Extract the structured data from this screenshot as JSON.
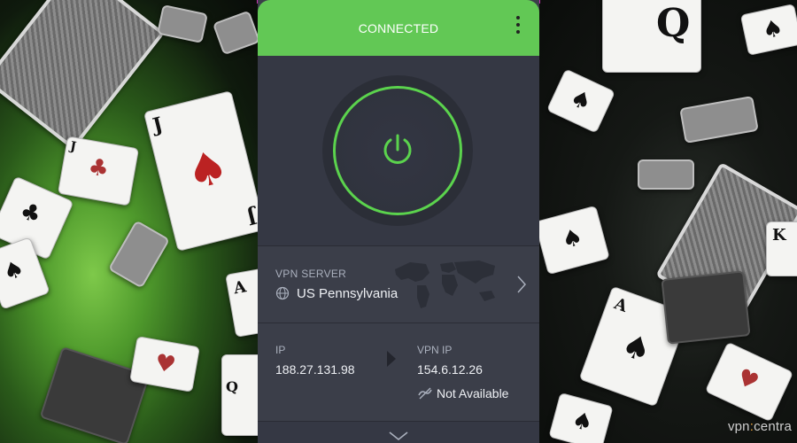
{
  "vpn": {
    "status": "CONNECTED",
    "menu_icon": "kebab-menu-icon",
    "power_icon": "power-icon",
    "colors": {
      "header_green": "#62c855",
      "ring_green": "#5bd34d",
      "panel_bg": "#3b3e49"
    },
    "server": {
      "label": "VPN SERVER",
      "value": "US Pennsylvania",
      "icon": "globe-icon",
      "chevron": "chevron-right-icon"
    },
    "ip": {
      "label": "IP",
      "value": "188.27.131.98"
    },
    "vpn_ip": {
      "label": "VPN IP",
      "value": "154.6.12.26",
      "ipv6_status": "Not Available",
      "ipv6_icon": "ipv6-unavailable-icon"
    },
    "expand_icon": "chevron-down-icon"
  },
  "watermark": {
    "prefix": "vpn",
    "suffix": "centra"
  }
}
